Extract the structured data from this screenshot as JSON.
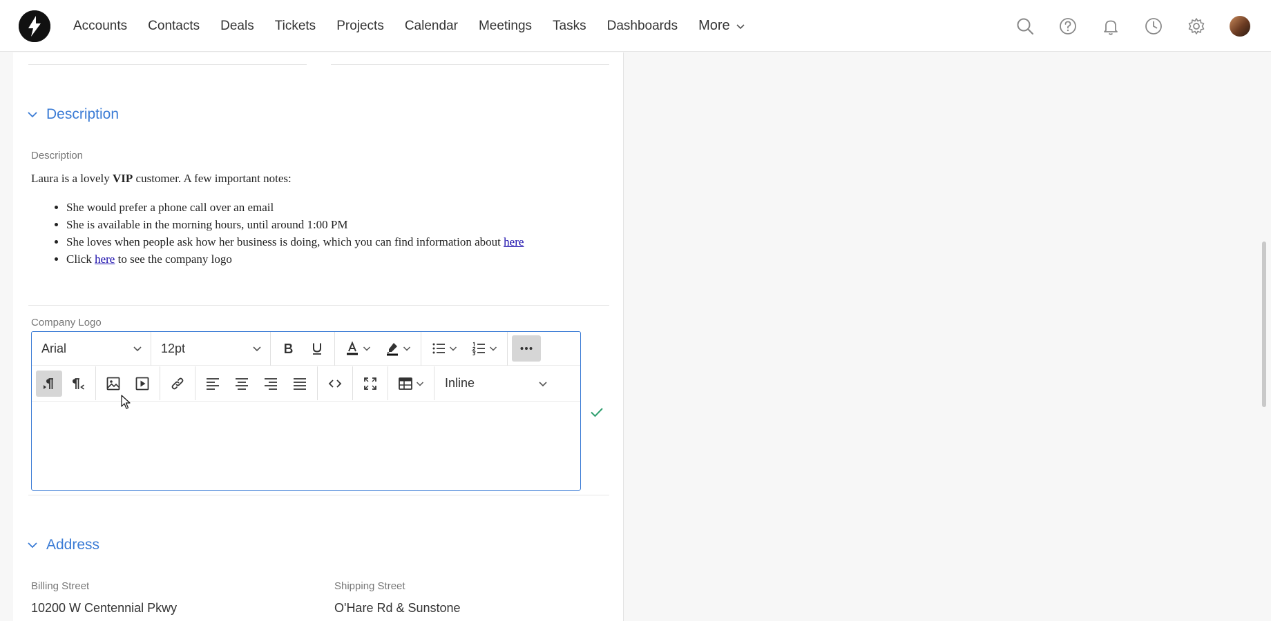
{
  "nav": {
    "items": [
      {
        "label": "Accounts",
        "id": "accounts"
      },
      {
        "label": "Contacts",
        "id": "contacts"
      },
      {
        "label": "Deals",
        "id": "deals"
      },
      {
        "label": "Tickets",
        "id": "tickets"
      },
      {
        "label": "Projects",
        "id": "projects"
      },
      {
        "label": "Calendar",
        "id": "calendar"
      },
      {
        "label": "Meetings",
        "id": "meetings"
      },
      {
        "label": "Tasks",
        "id": "tasks"
      },
      {
        "label": "Dashboards",
        "id": "dashboards"
      }
    ],
    "more_label": "More",
    "icons": [
      "search-icon",
      "help-icon",
      "bell-icon",
      "clock-icon",
      "gear-icon"
    ]
  },
  "description_section": {
    "title": "Description",
    "field_label": "Description",
    "intro_pre": "Laura is a lovely ",
    "intro_bold": "VIP",
    "intro_post": " customer. A few important notes:",
    "bullets": {
      "b1": "She would prefer a phone call over an email",
      "b2": "She is available in the morning hours, until around 1:00 PM",
      "b3_text": "She loves when people ask how her business is doing, which you can find information about ",
      "b3_link": "here",
      "b4_pre": "Click ",
      "b4_link": "here",
      "b4_post": " to see the company logo"
    }
  },
  "company_logo": {
    "label": "Company Logo",
    "editor": {
      "font_family": "Arial",
      "font_size": "12pt",
      "embed_mode": "Inline",
      "value": ""
    }
  },
  "address_section": {
    "title": "Address",
    "billing_street_label": "Billing Street",
    "billing_street_value": "10200 W Centennial Pkwy",
    "shipping_street_label": "Shipping Street",
    "shipping_street_value": "O'Hare Rd & Sunstone"
  },
  "colors": {
    "accent": "#3a7bd5",
    "success": "#2e9e6e",
    "link": "#1a0dab"
  }
}
